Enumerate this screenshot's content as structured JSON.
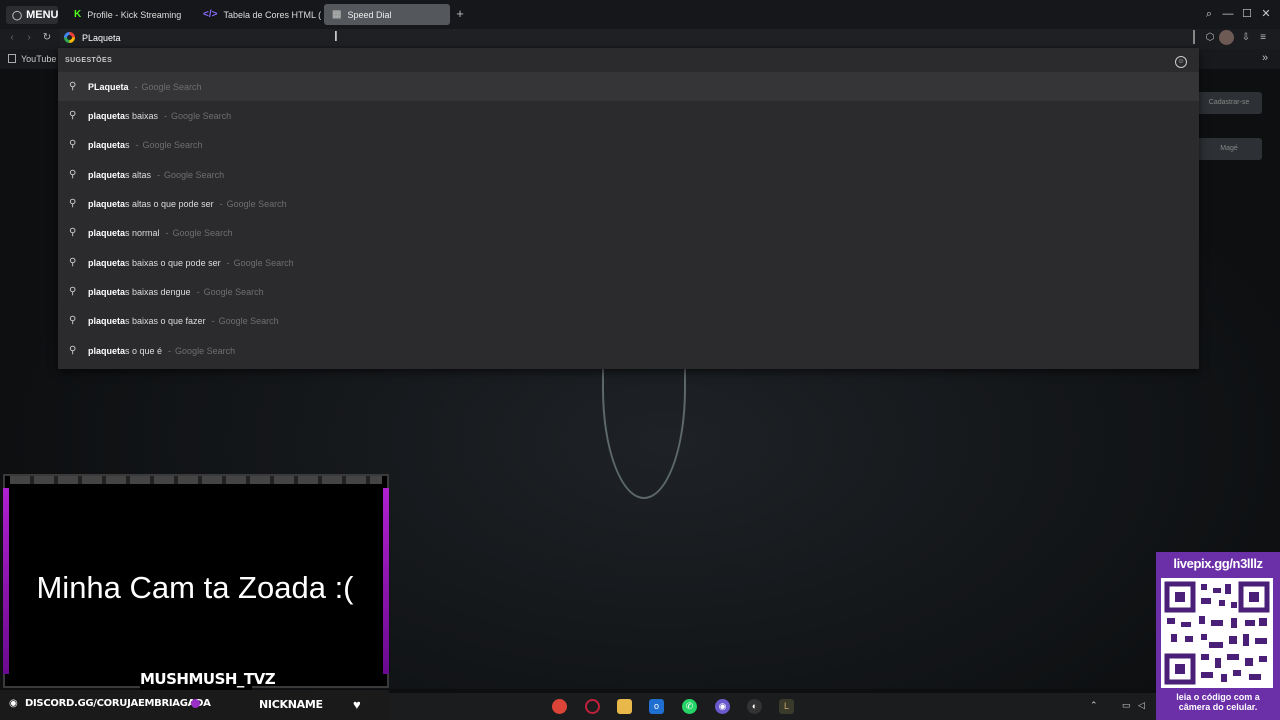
{
  "browser": {
    "menu_label": "MENU",
    "tabs": [
      {
        "label": "Profile - Kick Streaming",
        "icon": "kick-icon"
      },
      {
        "label": "Tabela de Cores HTML (h",
        "icon": "code-icon"
      },
      {
        "label": "Speed Dial",
        "icon": "speed-dial-icon",
        "active": true
      }
    ],
    "address_value": "PLaqueta",
    "bookmark": "YouTube"
  },
  "dropdown": {
    "header": "SUGESTÕES",
    "engine": "Google Search",
    "suggestions": [
      {
        "bold": "PLaqueta",
        "rest": ""
      },
      {
        "bold": "plaqueta",
        "rest": "s baixas"
      },
      {
        "bold": "plaqueta",
        "rest": "s"
      },
      {
        "bold": "plaqueta",
        "rest": "s altas"
      },
      {
        "bold": "plaqueta",
        "rest": "s altas o que pode ser"
      },
      {
        "bold": "plaqueta",
        "rest": "s normal"
      },
      {
        "bold": "plaqueta",
        "rest": "s baixas o que pode ser"
      },
      {
        "bold": "plaqueta",
        "rest": "s baixas dengue"
      },
      {
        "bold": "plaqueta",
        "rest": "s baixas o que fazer"
      },
      {
        "bold": "plaqueta",
        "rest": "s o que é"
      }
    ]
  },
  "background_page": {
    "button1": "Cadastrar-se",
    "button2": "Magé"
  },
  "stream": {
    "cam_message": "Minha Cam ta Zoada :(",
    "channel_name": "MUSHMUSH_TVZ",
    "discord": "DISCORD.GG/CORUJAEMBRIAGADA",
    "nickname": "NICKNAME",
    "qr_title": "livepix.gg/n3lllz",
    "qr_caption_1": "leia o código com a",
    "qr_caption_2": "câmera do celular."
  },
  "colors": {
    "accent_purple": "#6b2fa8",
    "cam_glow": "#b020d0",
    "dropdown_bg": "#2b2b2d"
  }
}
